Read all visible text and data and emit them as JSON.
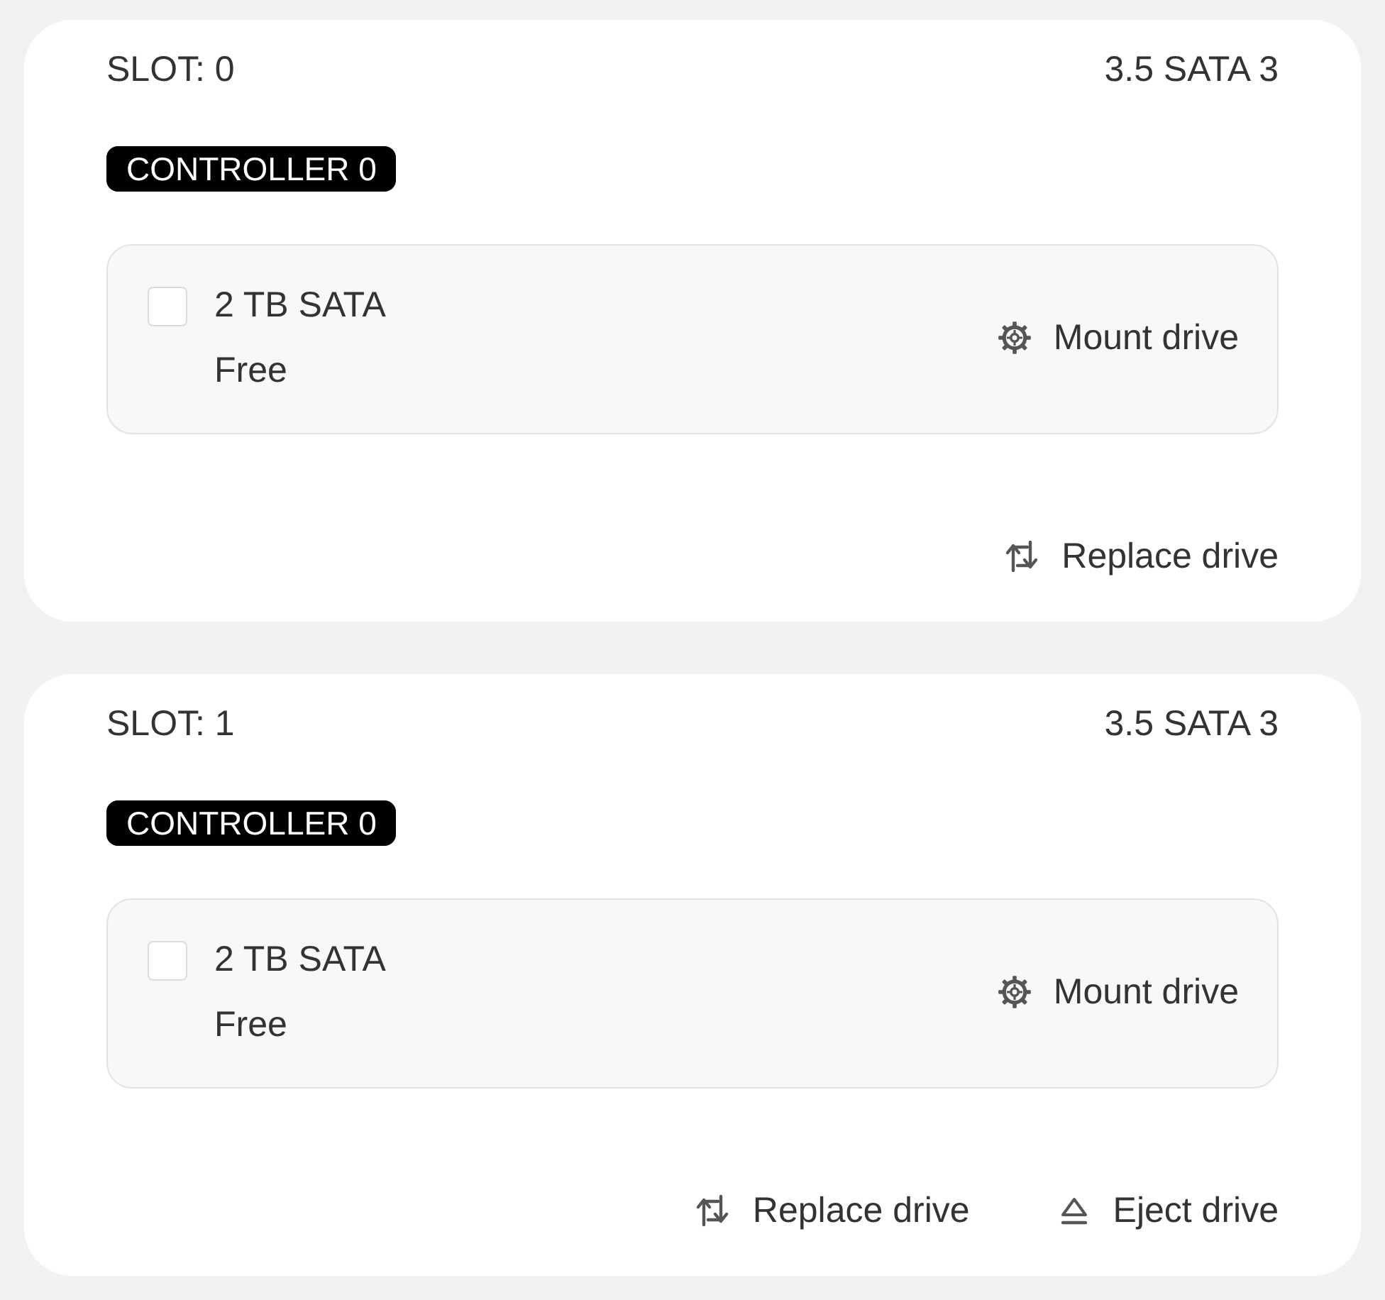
{
  "slots": [
    {
      "slot_label": "SLOT: 0",
      "drive_type": "3.5 SATA 3",
      "controller": "CONTROLLER 0",
      "drive": {
        "checked": false,
        "capacity": "2 TB SATA",
        "status": "Free",
        "action": "Mount drive"
      },
      "actions": [
        {
          "kind": "replace",
          "label": "Replace drive"
        }
      ]
    },
    {
      "slot_label": "SLOT: 1",
      "drive_type": "3.5 SATA 3",
      "controller": "CONTROLLER 0",
      "drive": {
        "checked": false,
        "capacity": "2 TB SATA",
        "status": "Free",
        "action": "Mount drive"
      },
      "actions": [
        {
          "kind": "replace",
          "label": "Replace drive"
        },
        {
          "kind": "eject",
          "label": "Eject drive"
        }
      ]
    }
  ]
}
